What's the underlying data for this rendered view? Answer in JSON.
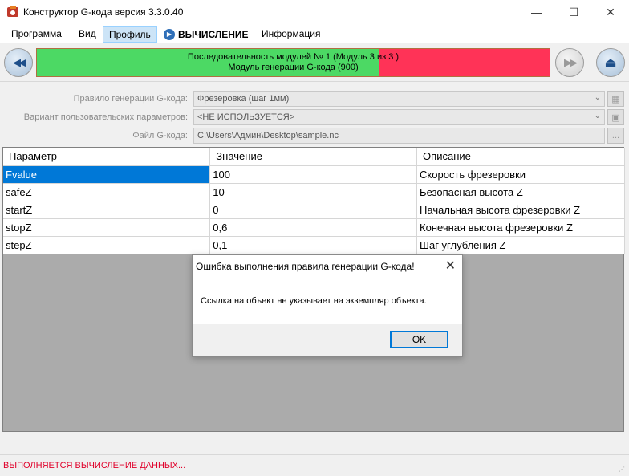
{
  "window": {
    "title": "Конструктор G-кода версия 3.3.0.40",
    "min_glyph": "—",
    "max_glyph": "☐",
    "close_glyph": "✕",
    "icon": "app-logo-icon"
  },
  "menu": {
    "program": "Программа",
    "view": "Вид",
    "profile": "Профиль",
    "calculation": "ВЫЧИСЛЕНИЕ",
    "info": "Информация"
  },
  "toolbar": {
    "back_glyph": "◀◀",
    "forward_glyph": "▶▶",
    "eject_glyph": "⏏",
    "progress_line1": "Последовательность модулей № 1 (Модуль 3 из 3 )",
    "progress_line2": "Модуль генерации G-кода (900)",
    "progress_fraction": 0.666,
    "progress_done_color": "#4cd964",
    "progress_remaining_color": "#ff3357"
  },
  "form": {
    "rule_label": "Правило генерации G-кода:",
    "rule_value": "Фрезеровка (шаг 1мм)",
    "variant_label": "Вариант пользовательских параметров:",
    "variant_value": "<НЕ ИСПОЛЬЗУЕТСЯ>",
    "file_label": "Файл G-кода:",
    "file_value": "C:\\Users\\Админ\\Desktop\\sample.nc",
    "file_button": "..."
  },
  "grid": {
    "headers": [
      "Параметр",
      "Значение",
      "Описание"
    ],
    "rows": [
      [
        "Fvalue",
        "100",
        "Скорость фрезеровки"
      ],
      [
        "safeZ",
        "10",
        "Безопасная высота Z"
      ],
      [
        "startZ",
        "0",
        "Начальная высота фрезеровки Z"
      ],
      [
        "stopZ",
        "0,6",
        "Конечная высота фрезеровки Z"
      ],
      [
        "stepZ",
        "0,1",
        "Шаг углубления Z"
      ]
    ]
  },
  "dialog": {
    "title": "Ошибка выполнения правила генерации G-кода!",
    "message": "Ссылка на объект не указывает на экземпляр объекта.",
    "ok_label": "OK",
    "close_glyph": "✕"
  },
  "status": {
    "text": "ВЫПОЛНЯЕТСЯ ВЫЧИСЛЕНИЕ ДАННЫХ...",
    "color": "#e0002a"
  }
}
